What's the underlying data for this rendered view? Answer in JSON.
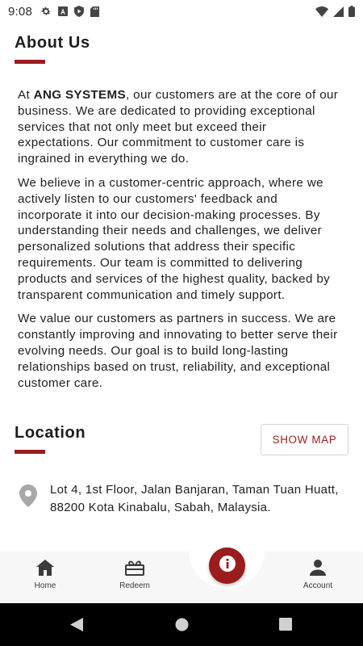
{
  "status_bar": {
    "time": "9:08",
    "left_icons": [
      "gear-icon",
      "a-box-icon",
      "shield-play-icon",
      "sd-card-icon"
    ],
    "right_icons": [
      "wifi-icon",
      "cell-signal-icon",
      "battery-icon"
    ]
  },
  "about": {
    "title": "About Us",
    "paragraph1": {
      "prefix": "At ",
      "company": "ANG SYSTEMS",
      "text": ", our customers are at the core of our business. We are dedicated to providing exceptional services that not only meet but exceed their expectations. Our commitment to customer care is ingrained in everything we do."
    },
    "paragraph2": "We believe in a customer-centric approach, where we actively listen to our customers' feedback and incorporate it into our decision-making processes. By understanding their needs and challenges, we deliver personalized solutions that address their specific requirements. Our team is committed to delivering products and services of the highest quality, backed by transparent communication and timely support.",
    "paragraph3": "We value our customers as partners in success. We are constantly improving and innovating to better serve their evolving needs. Our goal is to build long-lasting relationships based on trust, reliability, and exceptional customer care."
  },
  "location": {
    "title": "Location",
    "show_map_label": "SHOW MAP",
    "address_line1": "Lot 4, 1st Floor, Jalan Banjaran, Taman Tuan Huatt,",
    "address_line2": "88200 Kota Kinabalu, Sabah, Malaysia."
  },
  "bottom_nav": {
    "home_label": "Home",
    "redeem_label": "Redeem",
    "account_label": "Account",
    "fab_icon": "info-icon"
  },
  "colors": {
    "accent": "#9b1c1c",
    "nav_background": "#f7f7f7",
    "text": "#202020"
  }
}
